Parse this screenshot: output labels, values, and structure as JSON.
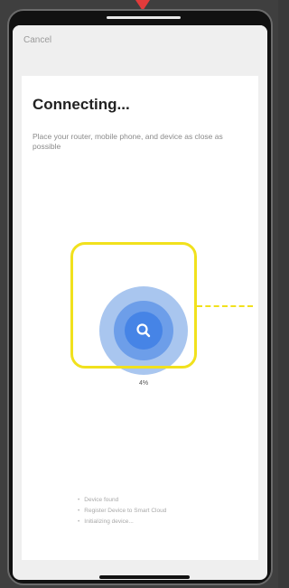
{
  "header": {
    "cancel_label": "Cancel"
  },
  "connect": {
    "title": "Connecting...",
    "subtitle": "Place your router, mobile phone, and device as close as possible",
    "progress_label": "4%"
  },
  "steps": [
    "Device found",
    "Register Device to Smart Cloud",
    "Initializing device..."
  ],
  "colors": {
    "accent": "#4684e6",
    "highlight": "#f1e11d",
    "pointer": "#e23b3b"
  },
  "icons": {
    "scan": "search-icon"
  }
}
